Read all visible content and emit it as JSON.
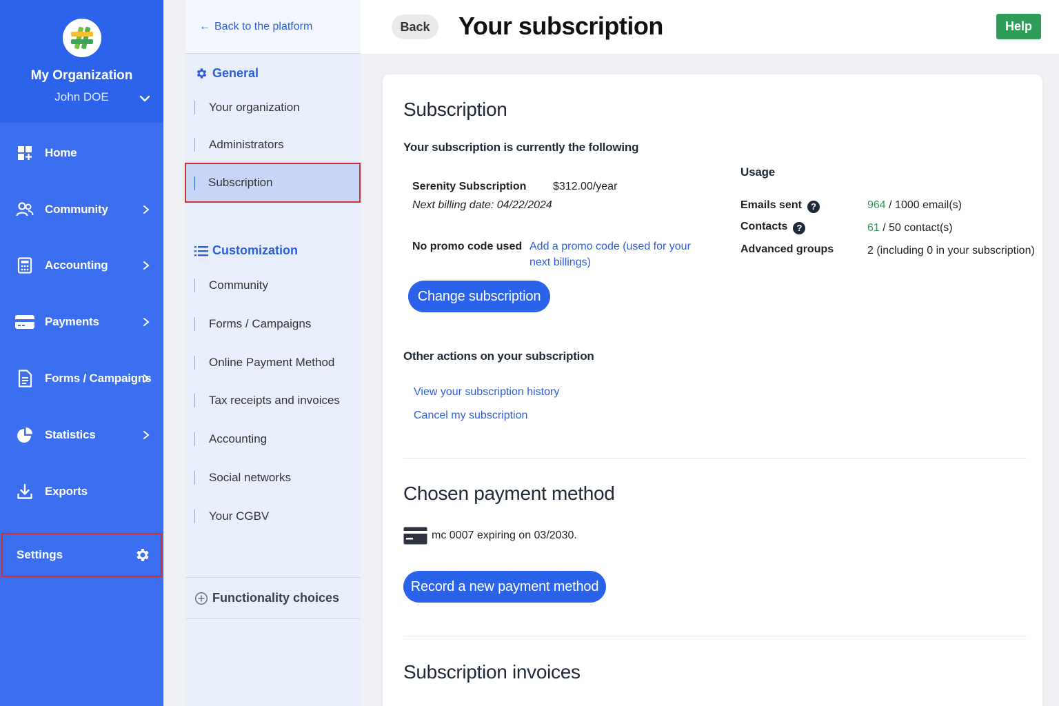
{
  "sidebar": {
    "org_name": "My Organization",
    "user_name": "John DOE",
    "items": [
      {
        "label": "Home"
      },
      {
        "label": "Community"
      },
      {
        "label": "Accounting"
      },
      {
        "label": "Payments"
      },
      {
        "label": "Forms / Campaigns"
      },
      {
        "label": "Statistics"
      },
      {
        "label": "Exports"
      }
    ],
    "settings_label": "Settings"
  },
  "subpanel": {
    "back_label": "Back to the platform",
    "general_title": "General",
    "general_items": [
      {
        "label": "Your organization"
      },
      {
        "label": "Administrators"
      },
      {
        "label": "Subscription"
      }
    ],
    "customization_title": "Customization",
    "customization_items": [
      {
        "label": "Community"
      },
      {
        "label": "Forms / Campaigns"
      },
      {
        "label": "Online Payment Method"
      },
      {
        "label": "Tax receipts and invoices"
      },
      {
        "label": "Accounting"
      },
      {
        "label": "Social networks"
      },
      {
        "label": "Your CGBV"
      }
    ],
    "functionality_title": "Functionality choices"
  },
  "header": {
    "back_label": "Back",
    "title": "Your subscription",
    "help_label": "Help"
  },
  "subscription": {
    "heading": "Subscription",
    "intro": "Your subscription is currently the following",
    "plan_name": "Serenity Subscription",
    "plan_price": "$312.00/year",
    "next_billing": "Next billing date: 04/22/2024",
    "promo_status": "No promo code used",
    "promo_link": "Add a promo code (used for your next billings)",
    "change_button": "Change subscription",
    "usage_title": "Usage",
    "usage": {
      "emails_label": "Emails sent",
      "emails_used": "964",
      "emails_rest": " / 1000 email(s)",
      "contacts_label": "Contacts",
      "contacts_used": "61",
      "contacts_rest": " / 50 contact(s)",
      "groups_label": "Advanced groups",
      "groups_value": "2 (including 0 in your subscription)"
    },
    "other_actions_title": "Other actions on your subscription",
    "history_link": "View your subscription history",
    "cancel_link": "Cancel my subscription"
  },
  "payment": {
    "heading": "Chosen payment method",
    "card_text": "mc 0007 expiring on 03/2030.",
    "record_button": "Record a new payment method"
  },
  "invoices": {
    "heading": "Subscription invoices"
  },
  "colors": {
    "sidebar": "#3c6ef0",
    "accent": "#2a62ea",
    "link": "#2b5fd8",
    "help": "#2e9b58",
    "highlight_border": "#d32f2f"
  }
}
